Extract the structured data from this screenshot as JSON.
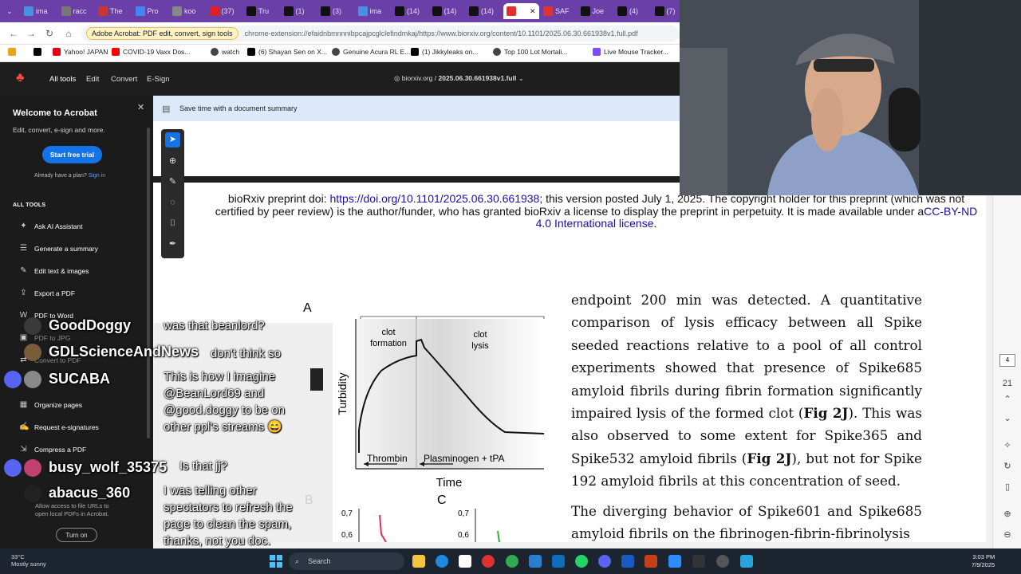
{
  "browser": {
    "tabs": [
      "ima",
      "racc",
      "The",
      "Pro",
      "koo",
      "(37)",
      "Tru",
      "(1)",
      "(3)",
      "ima",
      "(14)",
      "(14)",
      "(14)",
      "",
      "SAF",
      "Joe",
      "(4)",
      "(7)"
    ],
    "url_chip": "Adobe Acrobat: PDF edit, convert, sign tools",
    "url": "chrome-extension://efaidnbmnnnibpcajpcglclefindmkaj/https://www.biorxiv.org/content/10.1101/2025.06.30.661938v1.full.pdf",
    "bookmarks": [
      "Yahoo! JAPAN",
      "COVID-19 Vaxx Dos...",
      "watch",
      "(6) Shayan Sen on X...",
      "Genuine Acura RL E...",
      "(1) Jikkyleaks on...",
      "Top 100 Lot Mortali...",
      "Live Mouse Tracker..."
    ]
  },
  "acrobat": {
    "menu": [
      "All tools",
      "Edit",
      "Convert",
      "E-Sign"
    ],
    "breadcrumb_site": "biorxiv.org",
    "breadcrumb_sep": "/",
    "breadcrumb_file": "2025.06.30.661938v1.full",
    "summary_bar": "Save time with a document summary"
  },
  "sidebar": {
    "title": "Welcome to Acrobat",
    "subtitle": "Edit, convert, e-sign and more.",
    "trial_button": "Start free trial",
    "have_plan": "Already have a plan?",
    "sign_in": "Sign in",
    "section": "ALL TOOLS",
    "items": [
      "Ask AI Assistant",
      "Generate a summary",
      "Edit text & images",
      "Export a PDF",
      "PDF to Word",
      "PDF to JPG",
      "Convert to PDF",
      "Organize pages",
      "Request e-signatures",
      "Compress a PDF"
    ],
    "allow_text": "Allow access to file URLs to open local PDFs in Acrobat.",
    "turn_on": "Turn on"
  },
  "document": {
    "preprint_prefix": "bioRxiv preprint doi: ",
    "doi_link": "https://doi.org/10.1101/2025.06.30.661938",
    "preprint_rest": "; this version posted July 1, 2025. The copyright holder for this preprint (which was not certified by peer review) is the author/funder, who has granted bioRxiv a license to display the preprint in perpetuity. It is made available under a",
    "license_link": "CC-BY-ND 4.0 International license",
    "license_end": ".",
    "para1_a": "endpoint 200 min was detected. A quantitative comparison of lysis efficacy between all Spike seeded reactions relative to a pool of all control experiments showed that presence of Spike685 amyloid fibrils during fibrin formation significantly impaired lysis of the formed clot (",
    "fig_ref1": "Fig 2J",
    "para1_b": "). This was also observed to some extent for Spike365 and Spike532 amyloid fibrils (",
    "fig_ref2": "Fig 2J",
    "para1_c": "), but not for Spike 192 amyloid fibrils at this concentration of seed.",
    "para2": "The diverging behavior of Spike601 and Spike685 amyloid fibrils on the fibrinogen-fibrin-fibrinolysis"
  },
  "figure": {
    "panel_a": "A",
    "panel_b": "B",
    "panel_c": "C",
    "clot_formation_1": "clot",
    "clot_formation_2": "formation",
    "clot_lysis_1": "clot",
    "clot_lysis_2": "lysis",
    "ylabel": "Turbidity",
    "xlabel": "Time",
    "thrombin": "Thrombin",
    "plasminogen": "Plasminogen + tPA",
    "tick_b1": "0,7",
    "tick_b2": "0,6",
    "tick_c1": "0,7",
    "tick_c2": "0,6"
  },
  "chat": {
    "names": [
      "GoodDoggy",
      "GDLScienceAndNews",
      "SUCABA",
      "busy_wolf_35375",
      "abacus_360"
    ],
    "messages": [
      "was that beanlord?",
      "don't think so",
      "This is how I imagine @BeanLord69 and @good.doggy to be on other ppl's streams 😄",
      "Is that jj?",
      "I was telling other spectators to refresh the page to clean the spam, thanks, not you doc. Thanks"
    ]
  },
  "rightrail": {
    "page_current": "4",
    "page_total": "21"
  },
  "taskbar": {
    "temp": "33°C",
    "weather": "Mostly sunny",
    "search": "Search",
    "time": "3:03 PM",
    "date": "7/9/2025"
  },
  "colors": {
    "tabstrip": "#6b3fa8",
    "acrobat_blue": "#1473e6",
    "acrobat_red": "#ff4a3d",
    "summary_bar": "#dce9fa"
  }
}
